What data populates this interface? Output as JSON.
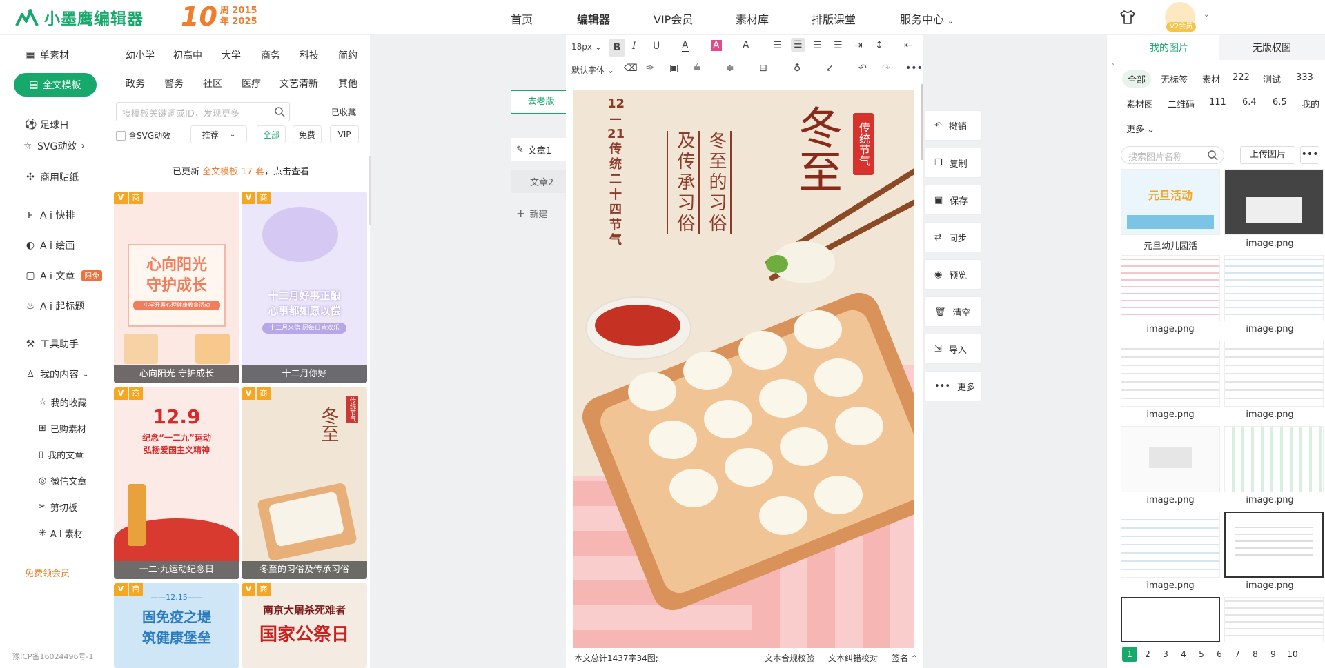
{
  "header": {
    "brand": "小墨鹰编辑器",
    "anniversary": {
      "ten": "10",
      "line1": "周 2015",
      "line2": "年 2025"
    },
    "nav": [
      "首页",
      "编辑器",
      "VIP会员",
      "素材库",
      "排版课堂",
      "服务中心"
    ],
    "active_nav": "编辑器",
    "vip_tag": "V2会员"
  },
  "left_nav": {
    "single": "单素材",
    "full_template": "全文模板",
    "worldcup": "足球日",
    "svg": "SVG动效",
    "sticker": "商用贴纸",
    "ai_layout": "A i 快排",
    "ai_draw": "A i 绘画",
    "ai_article": "A i 文章",
    "limited": "限免",
    "ai_title": "A i 起标题",
    "tools": "工具助手",
    "my_content": "我的内容",
    "sub": [
      "我的收藏",
      "已购素材",
      "我的文章",
      "微信文章",
      "剪切板",
      "A I 素材"
    ],
    "free_vip": "免费领会员",
    "icp": "豫ICP备16024496号-1"
  },
  "template_panel": {
    "categories_row1": [
      "幼小学",
      "初高中",
      "大学",
      "商务",
      "科技",
      "简约"
    ],
    "categories_row2": [
      "政务",
      "警务",
      "社区",
      "医疗",
      "文艺清新",
      "其他"
    ],
    "search_placeholder": "搜模板关键词或ID，发现更多",
    "collected": "已收藏",
    "svg_filter": "含SVG动效",
    "sort": "推荐",
    "filters": [
      "全部",
      "免费",
      "VIP"
    ],
    "update_prefix": "已更新",
    "update_type": "全文模板",
    "update_count": "17 套",
    "update_suffix": "，点击查看",
    "cards": [
      {
        "caption": "心向阳光 守护成长",
        "title": "心向阳光\n守护成长",
        "sub": "小学开展心理健康教育活动"
      },
      {
        "caption": "十二月你好",
        "title": "十二月好事正酿\n心事都如愿以偿",
        "sub": "十二月来信 愿每日皆欢乐"
      },
      {
        "caption": "一二·九运动纪念日",
        "title": "12.9",
        "sub": "纪念“一二九”运动\n弘扬爱国主义精神"
      },
      {
        "caption": "冬至的习俗及传承习俗",
        "title": "冬至",
        "sub": "传统节气"
      },
      {
        "caption": "",
        "title": "固免疫之堤\n筑健康堡垒",
        "sub": "——12.15——"
      },
      {
        "caption": "",
        "title": "国家公祭日",
        "sub": "南京大屠杀死难者"
      }
    ],
    "card_badge_v": "V",
    "card_badge_s": "商"
  },
  "workspace": {
    "old_version": "去老版",
    "articles": [
      "文章1",
      "文章2"
    ],
    "new": "新建"
  },
  "toolbar": {
    "font_size": "18px",
    "default_font": "默认字体",
    "row1": [
      "B",
      "I",
      "U",
      "A",
      "A",
      "A"
    ]
  },
  "canvas": {
    "date": "12\n—\n21\n传统二十四节气",
    "col1": "及传承习俗",
    "col2": "冬至的习俗",
    "big": "冬至",
    "seal": "传统节气"
  },
  "status": {
    "count": "本文总计1437字34图;",
    "check1": "文本合规校验",
    "check2": "文本纠错校对",
    "sign": "签名"
  },
  "ops": [
    "撤销",
    "复制",
    "保存",
    "同步",
    "预览",
    "清空",
    "导入",
    "更多"
  ],
  "right_panel": {
    "tabs": [
      "我的图片",
      "无版权图"
    ],
    "tags_row1": [
      "全部",
      "无标签",
      "素材",
      "222",
      "测试",
      "333"
    ],
    "tags_row2": [
      "素材图",
      "二维码",
      "111",
      "6.4",
      "6.5",
      "我的"
    ],
    "more": "更多",
    "search_placeholder": "搜索图片名称",
    "upload": "上传图片",
    "dots": "•••",
    "images": [
      "元旦幼儿园活",
      "image.png",
      "image.png",
      "image.png",
      "image.png",
      "image.png",
      "image.png",
      "image.png",
      "image.png",
      "image.png"
    ],
    "thumb_title": "元旦活动",
    "pages": [
      "1",
      "2",
      "3",
      "4",
      "5",
      "6",
      "7",
      "8",
      "9",
      "10"
    ]
  },
  "colors": {
    "accent": "#17a96c",
    "orange": "#f07d2c"
  }
}
